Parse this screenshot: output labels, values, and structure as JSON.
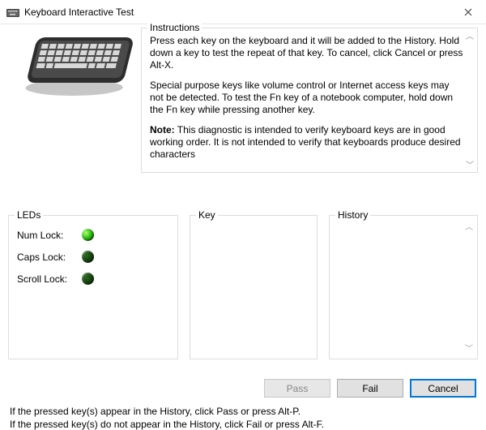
{
  "window": {
    "title": "Keyboard Interactive Test"
  },
  "instructions": {
    "legend": "Instructions",
    "p1": "Press each key on the keyboard and it will be added to the History. Hold down a key to test the repeat of that key. To cancel, click Cancel or press Alt-X.",
    "p2": "Special purpose keys like volume control or Internet access keys may not be detected. To test the Fn key of a notebook computer, hold down the Fn key while pressing another key.",
    "p3_prefix": "Note:",
    "p3_rest": " This diagnostic is intended to verify keyboard keys are in good working order. It is not intended to verify that keyboards produce desired characters"
  },
  "leds": {
    "legend": "LEDs",
    "num_label": "Num Lock:",
    "caps_label": "Caps Lock:",
    "scroll_label": "Scroll Lock:",
    "num_on": true,
    "caps_on": false,
    "scroll_on": false
  },
  "key": {
    "legend": "Key"
  },
  "history": {
    "legend": "History"
  },
  "buttons": {
    "pass": "Pass",
    "fail": "Fail",
    "cancel": "Cancel"
  },
  "hints": {
    "pass": "If the pressed key(s) appear in the History, click Pass or press Alt-P.",
    "fail": "If the pressed key(s) do not appear in the History, click Fail or press Alt-F."
  }
}
